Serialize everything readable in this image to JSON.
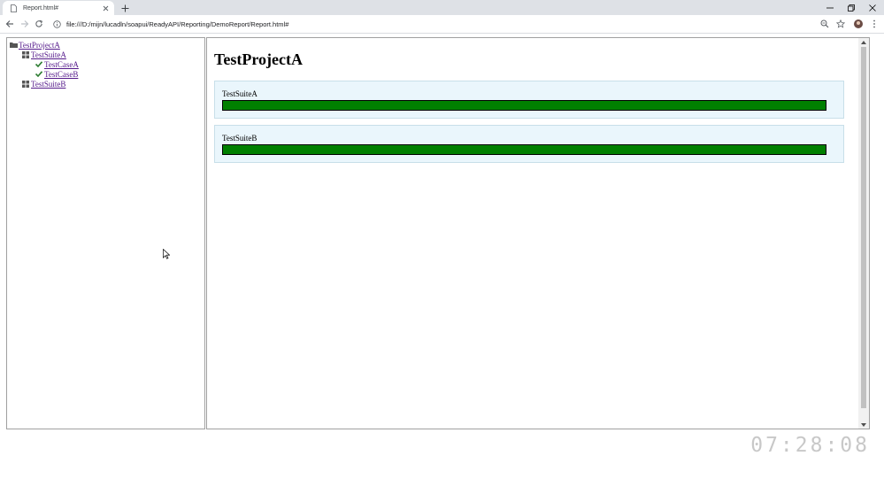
{
  "browser": {
    "tab_title": "Report.html#",
    "url": "file:///D:/mijn/lucadln/soapui/ReadyAPI/Reporting/DemoReport/Report.html#"
  },
  "tree": {
    "project": "TestProjectA",
    "suites": [
      {
        "label": "TestSuiteA",
        "cases": [
          "TestCaseA",
          "TestCaseB"
        ]
      },
      {
        "label": "TestSuiteB",
        "cases": []
      }
    ]
  },
  "main": {
    "title": "TestProjectA",
    "suites": [
      {
        "name": "TestSuiteA",
        "pass_fraction": 1.0
      },
      {
        "name": "TestSuiteB",
        "pass_fraction": 1.0
      }
    ]
  },
  "colors": {
    "pass": "#008000",
    "suite_bg": "#eaf6fc",
    "link": "#551a8b"
  },
  "clock": "07:28:08"
}
